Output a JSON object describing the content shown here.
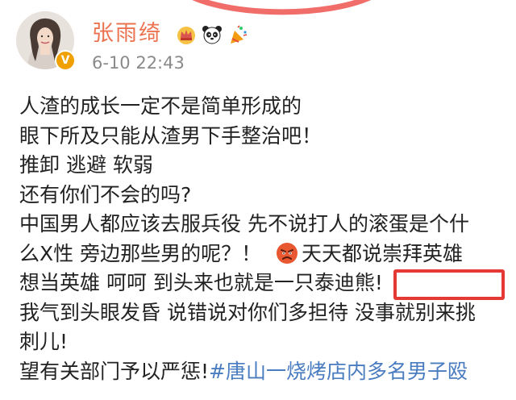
{
  "header": {
    "username": "张雨绮",
    "timestamp": "6-10 22:43",
    "verified_symbol": "V",
    "badges": [
      "crown-icon",
      "panda-icon",
      "party-icon"
    ]
  },
  "post": {
    "lines": [
      "人渣的成长一定不是简单形成的",
      "眼下所及只能从渣男下手整治吧！",
      "推卸 逃避 软弱",
      "还有你们不会的吗?",
      "中国男人都应该去服兵役 先不说打人的滚蛋是个什",
      "么X性 旁边那些男的呢？！",
      "天天都说崇拜英雄",
      "想当英雄 呵呵 到头来也就是一只泰迪熊!",
      "我气到头眼发昏 说错说对你们多担待 没事就别来挑",
      "刺儿!",
      "望有关部门予以严惩!",
      "#唐山一烧烤店内多名男子殴"
    ],
    "emoji": "angry-face-icon"
  },
  "colors": {
    "username": "#eb7350",
    "timestamp": "#8a8a8a",
    "text": "#222222",
    "hashtag": "#4a7cc0",
    "highlight": "#e53935",
    "verified": "#f0a000"
  }
}
